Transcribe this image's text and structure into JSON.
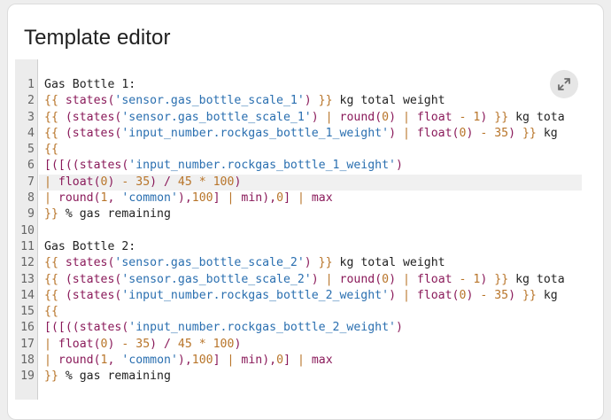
{
  "card": {
    "title": "Template editor"
  },
  "editor": {
    "expand_icon": "expand-diagonal-icon",
    "active_line": 7,
    "line_numbers": [
      "1",
      "2",
      "3",
      "4",
      "5",
      "6",
      "7",
      "8",
      "9",
      "10",
      "11",
      "12",
      "13",
      "14",
      "15",
      "16",
      "17",
      "18",
      "19"
    ],
    "lines": [
      [
        {
          "t": "plain",
          "v": "Gas Bottle 1:"
        }
      ],
      [
        {
          "t": "bracket",
          "v": "{{ "
        },
        {
          "t": "func",
          "v": "states("
        },
        {
          "t": "str",
          "v": "'sensor.gas_bottle_scale_1'"
        },
        {
          "t": "func",
          "v": ")"
        },
        {
          "t": "bracket",
          "v": " }}"
        },
        {
          "t": "plain",
          "v": " kg total weight"
        }
      ],
      [
        {
          "t": "bracket",
          "v": "{{ "
        },
        {
          "t": "func",
          "v": "(states("
        },
        {
          "t": "str",
          "v": "'sensor.gas_bottle_scale_1'"
        },
        {
          "t": "func",
          "v": ") "
        },
        {
          "t": "pipe",
          "v": "|"
        },
        {
          "t": "func",
          "v": " round("
        },
        {
          "t": "num",
          "v": "0"
        },
        {
          "t": "func",
          "v": ") "
        },
        {
          "t": "pipe",
          "v": "|"
        },
        {
          "t": "func",
          "v": " float "
        },
        {
          "t": "num",
          "v": "- 1"
        },
        {
          "t": "func",
          "v": ")"
        },
        {
          "t": "bracket",
          "v": " }}"
        },
        {
          "t": "plain",
          "v": " kg tota"
        }
      ],
      [
        {
          "t": "bracket",
          "v": "{{ "
        },
        {
          "t": "func",
          "v": "(states("
        },
        {
          "t": "str",
          "v": "'input_number.rockgas_bottle_1_weight'"
        },
        {
          "t": "func",
          "v": ") "
        },
        {
          "t": "pipe",
          "v": "|"
        },
        {
          "t": "func",
          "v": " float("
        },
        {
          "t": "num",
          "v": "0"
        },
        {
          "t": "func",
          "v": ") "
        },
        {
          "t": "num",
          "v": "- 35"
        },
        {
          "t": "func",
          "v": ")"
        },
        {
          "t": "bracket",
          "v": " }}"
        },
        {
          "t": "plain",
          "v": " kg"
        }
      ],
      [
        {
          "t": "bracket",
          "v": "{{"
        }
      ],
      [
        {
          "t": "func",
          "v": "[([((states("
        },
        {
          "t": "str",
          "v": "'input_number.rockgas_bottle_1_weight'"
        },
        {
          "t": "func",
          "v": ")"
        }
      ],
      [
        {
          "t": "pipe",
          "v": "|"
        },
        {
          "t": "func",
          "v": " float("
        },
        {
          "t": "num",
          "v": "0"
        },
        {
          "t": "func",
          "v": ") "
        },
        {
          "t": "num",
          "v": "- 35"
        },
        {
          "t": "func",
          "v": ") / "
        },
        {
          "t": "num",
          "v": "45 * 100"
        },
        {
          "t": "func",
          "v": ")"
        }
      ],
      [
        {
          "t": "pipe",
          "v": "|"
        },
        {
          "t": "func",
          "v": " round("
        },
        {
          "t": "num",
          "v": "1"
        },
        {
          "t": "func",
          "v": ", "
        },
        {
          "t": "str",
          "v": "'common'"
        },
        {
          "t": "func",
          "v": "),"
        },
        {
          "t": "num",
          "v": "100"
        },
        {
          "t": "func",
          "v": "] "
        },
        {
          "t": "pipe",
          "v": "|"
        },
        {
          "t": "func",
          "v": " min),"
        },
        {
          "t": "num",
          "v": "0"
        },
        {
          "t": "func",
          "v": "] "
        },
        {
          "t": "pipe",
          "v": "|"
        },
        {
          "t": "func",
          "v": " max"
        }
      ],
      [
        {
          "t": "bracket",
          "v": "}}"
        },
        {
          "t": "plain",
          "v": " % gas remaining"
        }
      ],
      [
        {
          "t": "plain",
          "v": ""
        }
      ],
      [
        {
          "t": "plain",
          "v": "Gas Bottle 2:"
        }
      ],
      [
        {
          "t": "bracket",
          "v": "{{ "
        },
        {
          "t": "func",
          "v": "states("
        },
        {
          "t": "str",
          "v": "'sensor.gas_bottle_scale_2'"
        },
        {
          "t": "func",
          "v": ")"
        },
        {
          "t": "bracket",
          "v": " }}"
        },
        {
          "t": "plain",
          "v": " kg total weight"
        }
      ],
      [
        {
          "t": "bracket",
          "v": "{{ "
        },
        {
          "t": "func",
          "v": "(states("
        },
        {
          "t": "str",
          "v": "'sensor.gas_bottle_scale_2'"
        },
        {
          "t": "func",
          "v": ") "
        },
        {
          "t": "pipe",
          "v": "|"
        },
        {
          "t": "func",
          "v": " round("
        },
        {
          "t": "num",
          "v": "0"
        },
        {
          "t": "func",
          "v": ") "
        },
        {
          "t": "pipe",
          "v": "|"
        },
        {
          "t": "func",
          "v": " float "
        },
        {
          "t": "num",
          "v": "- 1"
        },
        {
          "t": "func",
          "v": ")"
        },
        {
          "t": "bracket",
          "v": " }}"
        },
        {
          "t": "plain",
          "v": " kg tota"
        }
      ],
      [
        {
          "t": "bracket",
          "v": "{{ "
        },
        {
          "t": "func",
          "v": "(states("
        },
        {
          "t": "str",
          "v": "'input_number.rockgas_bottle_2_weight'"
        },
        {
          "t": "func",
          "v": ") "
        },
        {
          "t": "pipe",
          "v": "|"
        },
        {
          "t": "func",
          "v": " float("
        },
        {
          "t": "num",
          "v": "0"
        },
        {
          "t": "func",
          "v": ") "
        },
        {
          "t": "num",
          "v": "- 35"
        },
        {
          "t": "func",
          "v": ")"
        },
        {
          "t": "bracket",
          "v": " }}"
        },
        {
          "t": "plain",
          "v": " kg"
        }
      ],
      [
        {
          "t": "bracket",
          "v": "{{"
        }
      ],
      [
        {
          "t": "func",
          "v": "[([((states("
        },
        {
          "t": "str",
          "v": "'input_number.rockgas_bottle_2_weight'"
        },
        {
          "t": "func",
          "v": ")"
        }
      ],
      [
        {
          "t": "pipe",
          "v": "|"
        },
        {
          "t": "func",
          "v": " float("
        },
        {
          "t": "num",
          "v": "0"
        },
        {
          "t": "func",
          "v": ") "
        },
        {
          "t": "num",
          "v": "- 35"
        },
        {
          "t": "func",
          "v": ") / "
        },
        {
          "t": "num",
          "v": "45 * 100"
        },
        {
          "t": "func",
          "v": ")"
        }
      ],
      [
        {
          "t": "pipe",
          "v": "|"
        },
        {
          "t": "func",
          "v": " round("
        },
        {
          "t": "num",
          "v": "1"
        },
        {
          "t": "func",
          "v": ", "
        },
        {
          "t": "str",
          "v": "'common'"
        },
        {
          "t": "func",
          "v": "),"
        },
        {
          "t": "num",
          "v": "100"
        },
        {
          "t": "func",
          "v": "] "
        },
        {
          "t": "pipe",
          "v": "|"
        },
        {
          "t": "func",
          "v": " min),"
        },
        {
          "t": "num",
          "v": "0"
        },
        {
          "t": "func",
          "v": "] "
        },
        {
          "t": "pipe",
          "v": "|"
        },
        {
          "t": "func",
          "v": " max"
        }
      ],
      [
        {
          "t": "bracket",
          "v": "}}"
        },
        {
          "t": "plain",
          "v": " % gas remaining"
        }
      ]
    ]
  }
}
